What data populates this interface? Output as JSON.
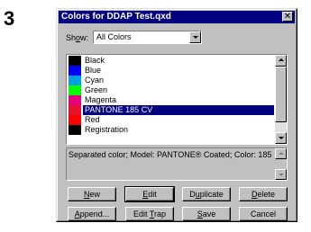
{
  "step_number": "3",
  "dialog": {
    "title": "Colors for DDAP Test.qxd",
    "close_glyph": "✕"
  },
  "show": {
    "label_pre": "Sh",
    "label_key": "o",
    "label_post": "w:",
    "value": "All Colors"
  },
  "colors": [
    {
      "name": "Black",
      "swatch": "#000000",
      "selected": false
    },
    {
      "name": "Blue",
      "swatch": "#0000ff",
      "selected": false
    },
    {
      "name": "Cyan",
      "swatch": "#00a0e8",
      "selected": false
    },
    {
      "name": "Green",
      "swatch": "#00ff00",
      "selected": false
    },
    {
      "name": "Magenta",
      "swatch": "#e4007f",
      "selected": false
    },
    {
      "name": "PANTONE 185 CV",
      "swatch": "#e8112d",
      "selected": true
    },
    {
      "name": "Red",
      "swatch": "#ff0000",
      "selected": false
    },
    {
      "name": "Registration",
      "swatch": "#000000",
      "selected": false
    }
  ],
  "description": "Separated color; Model: PANTONE® Coated; Color: 185",
  "buttons": {
    "new": {
      "pre": "",
      "key": "N",
      "post": "ew"
    },
    "edit": {
      "pre": "",
      "key": "E",
      "post": "dit"
    },
    "duplicate": {
      "pre": "D",
      "key": "u",
      "post": "plicate"
    },
    "delete": {
      "pre": "",
      "key": "D",
      "post": "elete"
    },
    "append": {
      "pre": "",
      "key": "A",
      "post": "ppend..."
    },
    "edit_trap": {
      "pre": "Edit ",
      "key": "T",
      "post": "rap"
    },
    "save": {
      "pre": "",
      "key": "S",
      "post": "ave"
    },
    "cancel": {
      "pre": "Cancel",
      "key": "",
      "post": ""
    }
  },
  "icons": {
    "close": "close-icon",
    "dropdown": "chevron-down-icon",
    "scroll_up": "arrow-up-icon",
    "scroll_down": "arrow-down-icon"
  }
}
